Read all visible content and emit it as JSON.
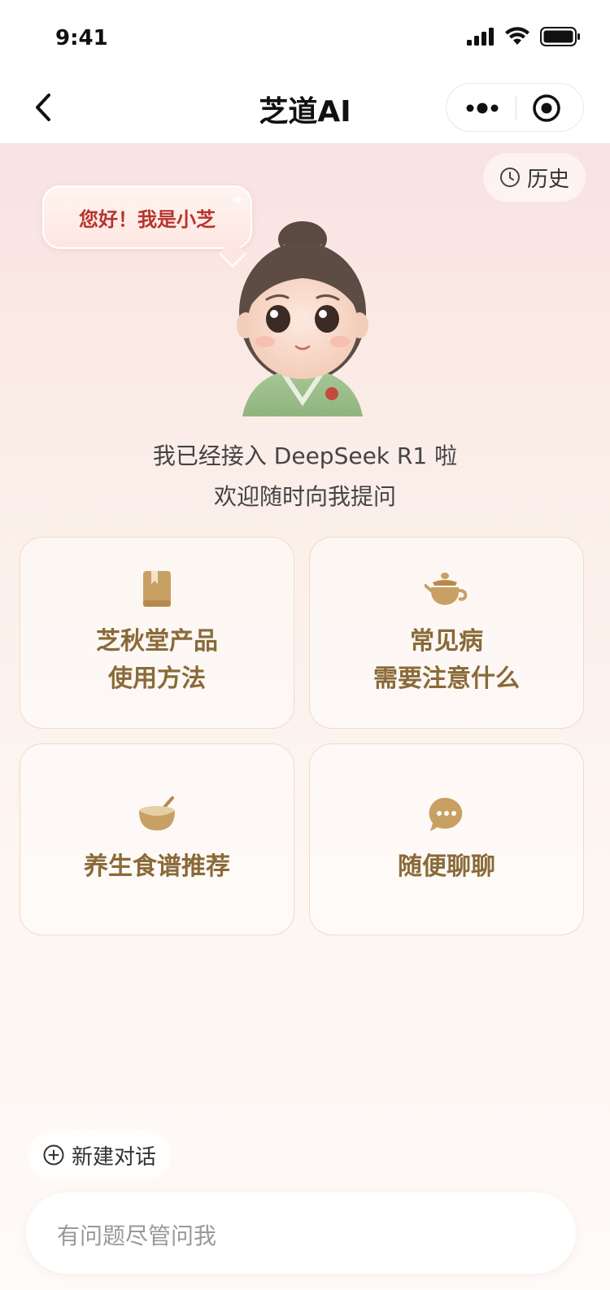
{
  "status_bar": {
    "time": "9:41"
  },
  "nav": {
    "title": "芝道AI"
  },
  "header": {
    "history_label": "历史"
  },
  "greeting": {
    "bubble_text": "您好！我是小芝"
  },
  "welcome": {
    "line1": "我已经接入 DeepSeek R1 啦",
    "line2": "欢迎随时向我提问"
  },
  "cards": [
    {
      "icon": "book-icon",
      "label": "芝秋堂产品\n使用方法"
    },
    {
      "icon": "teapot-icon",
      "label": "常见病\n需要注意什么"
    },
    {
      "icon": "bowl-icon",
      "label": "养生食谱推荐"
    },
    {
      "icon": "chat-bubble-icon",
      "label": "随便聊聊"
    }
  ],
  "footer": {
    "new_chat_label": "新建对话",
    "input_placeholder": "有问题尽管问我"
  },
  "colors": {
    "card_text": "#8a6a38",
    "icon_gold": "#c9a064",
    "bubble_text": "#b8342f"
  }
}
